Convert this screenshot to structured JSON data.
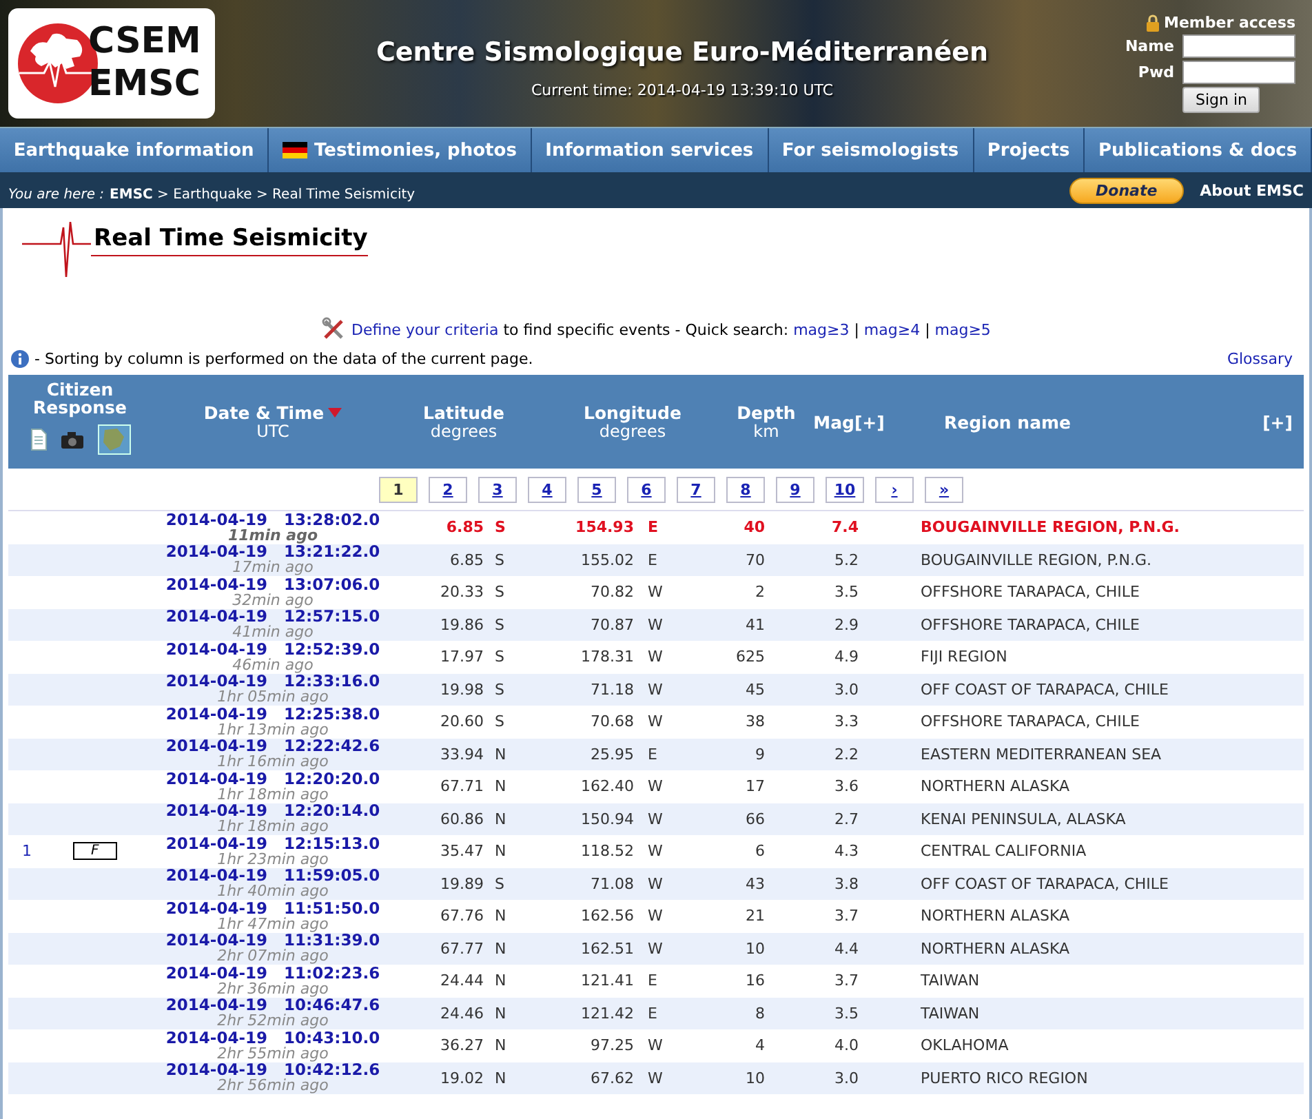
{
  "header": {
    "logo": {
      "line1": "CSEM",
      "line2": "EMSC"
    },
    "title": "Centre Sismologique Euro-Méditerranéen",
    "current_time": "Current time: 2014-04-19 13:39:10 UTC",
    "member_access": {
      "title": "Member access",
      "name_label": "Name",
      "pwd_label": "Pwd",
      "sign_in": "Sign in"
    }
  },
  "nav": [
    {
      "label": "Earthquake information",
      "kind": "plain"
    },
    {
      "label": "Testimonies, photos",
      "kind": "flag"
    },
    {
      "label": "Information services",
      "kind": "plain"
    },
    {
      "label": "For seismologists",
      "kind": "plain"
    },
    {
      "label": "Projects",
      "kind": "plain"
    },
    {
      "label": "Publications & docs",
      "kind": "plain"
    }
  ],
  "breadcrumb": {
    "prefix": "You are here :",
    "path": "**EMSC** > Earthquake > Real Time Seismicity",
    "donate": "Donate",
    "about": "About EMSC"
  },
  "page_title": "Real Time Seismicity",
  "criteria": {
    "link": "Define your criteria",
    "text": " to find specific events - Quick search: ",
    "quick_links": [
      "mag≥3",
      "mag≥4",
      "mag≥5"
    ],
    "separator": "|"
  },
  "note": {
    "text": "- Sorting by column is performed on the data of the current page.",
    "glossary": "Glossary"
  },
  "table": {
    "columns": [
      {
        "title": "Citizen Response",
        "kind": "citizen"
      },
      {
        "title": "Date & Time",
        "sub": "UTC",
        "sorted": true,
        "kind": "date"
      },
      {
        "title": "Latitude",
        "sub": "degrees",
        "sorted": false,
        "kind": "lat"
      },
      {
        "title": "Longitude",
        "sub": "degrees",
        "sorted": false,
        "kind": "lon"
      },
      {
        "title": "Depth",
        "sub": "km",
        "sorted": false,
        "kind": "depth"
      },
      {
        "title": "Mag[+]",
        "sorted": false,
        "kind": "mag"
      },
      {
        "title": "Region name",
        "sorted": false,
        "kind": "region"
      },
      {
        "title": "[+]",
        "kind": "more"
      }
    ],
    "pages": [
      {
        "label": "1",
        "selected": true
      },
      {
        "label": "2",
        "selected": false
      },
      {
        "label": "3",
        "selected": false
      },
      {
        "label": "4",
        "selected": false
      },
      {
        "label": "5",
        "selected": false
      },
      {
        "label": "6",
        "selected": false
      },
      {
        "label": "7",
        "selected": false
      },
      {
        "label": "8",
        "selected": false
      },
      {
        "label": "9",
        "selected": false
      },
      {
        "label": "10",
        "selected": false
      },
      {
        "label": "›",
        "selected": false
      },
      {
        "label": "»",
        "selected": false
      }
    ],
    "rows": [
      {
        "date": "2014-04-19",
        "time": "13:28:02.0",
        "ago": "11min ago",
        "lat": "6.85",
        "ns": "S",
        "lon": "154.93",
        "ew": "E",
        "depth": "40",
        "mag": "7.4",
        "region": "BOUGAINVILLE REGION, P.N.G.",
        "alert": true
      },
      {
        "date": "2014-04-19",
        "time": "13:21:22.0",
        "ago": "17min ago",
        "lat": "6.85",
        "ns": "S",
        "lon": "155.02",
        "ew": "E",
        "depth": "70",
        "mag": "5.2",
        "region": "BOUGAINVILLE REGION, P.N.G.",
        "alert": false
      },
      {
        "date": "2014-04-19",
        "time": "13:07:06.0",
        "ago": "32min ago",
        "lat": "20.33",
        "ns": "S",
        "lon": "70.82",
        "ew": "W",
        "depth": "2",
        "mag": "3.5",
        "region": "OFFSHORE TARAPACA, CHILE",
        "alert": false
      },
      {
        "date": "2014-04-19",
        "time": "12:57:15.0",
        "ago": "41min ago",
        "lat": "19.86",
        "ns": "S",
        "lon": "70.87",
        "ew": "W",
        "depth": "41",
        "mag": "2.9",
        "region": "OFFSHORE TARAPACA, CHILE",
        "alert": false
      },
      {
        "date": "2014-04-19",
        "time": "12:52:39.0",
        "ago": "46min ago",
        "lat": "17.97",
        "ns": "S",
        "lon": "178.31",
        "ew": "W",
        "depth": "625",
        "mag": "4.9",
        "region": "FIJI REGION",
        "alert": false
      },
      {
        "date": "2014-04-19",
        "time": "12:33:16.0",
        "ago": "1hr 05min ago",
        "lat": "19.98",
        "ns": "S",
        "lon": "71.18",
        "ew": "W",
        "depth": "45",
        "mag": "3.0",
        "region": "OFF COAST OF TARAPACA, CHILE",
        "alert": false
      },
      {
        "date": "2014-04-19",
        "time": "12:25:38.0",
        "ago": "1hr 13min ago",
        "lat": "20.60",
        "ns": "S",
        "lon": "70.68",
        "ew": "W",
        "depth": "38",
        "mag": "3.3",
        "region": "OFFSHORE TARAPACA, CHILE",
        "alert": false
      },
      {
        "date": "2014-04-19",
        "time": "12:22:42.6",
        "ago": "1hr 16min ago",
        "lat": "33.94",
        "ns": "N",
        "lon": "25.95",
        "ew": "E",
        "depth": "9",
        "mag": "2.2",
        "region": "EASTERN MEDITERRANEAN SEA",
        "alert": false
      },
      {
        "date": "2014-04-19",
        "time": "12:20:20.0",
        "ago": "1hr 18min ago",
        "lat": "67.71",
        "ns": "N",
        "lon": "162.40",
        "ew": "W",
        "depth": "17",
        "mag": "3.6",
        "region": "NORTHERN ALASKA",
        "alert": false
      },
      {
        "date": "2014-04-19",
        "time": "12:20:14.0",
        "ago": "1hr 18min ago",
        "lat": "60.86",
        "ns": "N",
        "lon": "150.94",
        "ew": "W",
        "depth": "66",
        "mag": "2.7",
        "region": "KENAI PENINSULA, ALASKA",
        "alert": false
      },
      {
        "date": "2014-04-19",
        "time": "12:15:13.0",
        "ago": "1hr 23min ago",
        "lat": "35.47",
        "ns": "N",
        "lon": "118.52",
        "ew": "W",
        "depth": "6",
        "mag": "4.3",
        "region": "CENTRAL CALIFORNIA",
        "alert": false,
        "testimonies": "1",
        "felt": "F"
      },
      {
        "date": "2014-04-19",
        "time": "11:59:05.0",
        "ago": "1hr 40min ago",
        "lat": "19.89",
        "ns": "S",
        "lon": "71.08",
        "ew": "W",
        "depth": "43",
        "mag": "3.8",
        "region": "OFF COAST OF TARAPACA, CHILE",
        "alert": false
      },
      {
        "date": "2014-04-19",
        "time": "11:51:50.0",
        "ago": "1hr 47min ago",
        "lat": "67.76",
        "ns": "N",
        "lon": "162.56",
        "ew": "W",
        "depth": "21",
        "mag": "3.7",
        "region": "NORTHERN ALASKA",
        "alert": false
      },
      {
        "date": "2014-04-19",
        "time": "11:31:39.0",
        "ago": "2hr 07min ago",
        "lat": "67.77",
        "ns": "N",
        "lon": "162.51",
        "ew": "W",
        "depth": "10",
        "mag": "4.4",
        "region": "NORTHERN ALASKA",
        "alert": false
      },
      {
        "date": "2014-04-19",
        "time": "11:02:23.6",
        "ago": "2hr 36min ago",
        "lat": "24.44",
        "ns": "N",
        "lon": "121.41",
        "ew": "E",
        "depth": "16",
        "mag": "3.7",
        "region": "TAIWAN",
        "alert": false
      },
      {
        "date": "2014-04-19",
        "time": "10:46:47.6",
        "ago": "2hr 52min ago",
        "lat": "24.46",
        "ns": "N",
        "lon": "121.42",
        "ew": "E",
        "depth": "8",
        "mag": "3.5",
        "region": "TAIWAN",
        "alert": false
      },
      {
        "date": "2014-04-19",
        "time": "10:43:10.0",
        "ago": "2hr 55min ago",
        "lat": "36.27",
        "ns": "N",
        "lon": "97.25",
        "ew": "W",
        "depth": "4",
        "mag": "4.0",
        "region": "OKLAHOMA",
        "alert": false
      },
      {
        "date": "2014-04-19",
        "time": "10:42:12.6",
        "ago": "2hr 56min ago",
        "lat": "19.02",
        "ns": "N",
        "lon": "67.62",
        "ew": "W",
        "depth": "10",
        "mag": "3.0",
        "region": "PUERTO RICO REGION",
        "alert": false
      }
    ]
  }
}
